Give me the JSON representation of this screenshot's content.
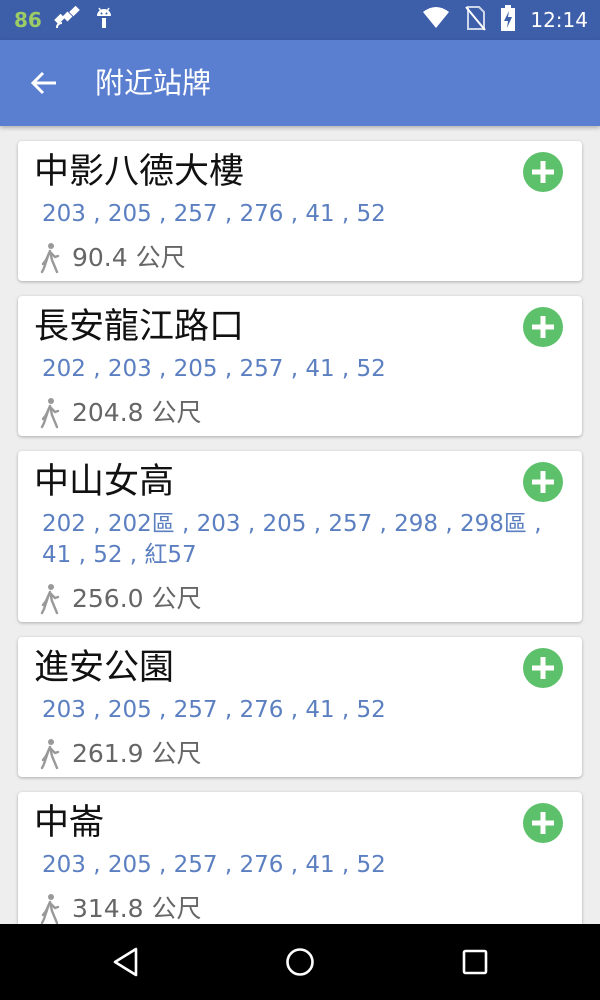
{
  "status_bar": {
    "badge": "86",
    "time": "12:14",
    "icons": [
      "satellite-fake-gps-icon",
      "android-debug-icon",
      "wifi-icon",
      "no-sim-icon",
      "battery-charging-icon"
    ]
  },
  "app_bar": {
    "title": "附近站牌",
    "back_icon": "arrow-back-icon"
  },
  "colors": {
    "status_bar": "#3d5ea8",
    "app_bar": "#5b7fd0",
    "route_text": "#5b7fc0",
    "add_button": "#5cc16a",
    "background": "#eeeeee"
  },
  "stops": [
    {
      "name": "中影八德大樓",
      "routes": "203 , 205 , 257 , 276 , 41 , 52",
      "distance": "90.4 公尺"
    },
    {
      "name": "長安龍江路口",
      "routes": "202 , 203 , 205 , 257 , 41 , 52",
      "distance": "204.8 公尺"
    },
    {
      "name": "中山女高",
      "routes": "202 , 202區 , 203 , 205 , 257 , 298 , 298區 , 41 , 52 , 紅57",
      "distance": "256.0 公尺"
    },
    {
      "name": "進安公園",
      "routes": "203 , 205 , 257 , 276 , 41 , 52",
      "distance": "261.9 公尺"
    },
    {
      "name": "中崙",
      "routes": "203 , 205 , 257 , 276 , 41 , 52",
      "distance": "314.8 公尺"
    }
  ],
  "nav_bar": {
    "buttons": [
      "back-triangle-icon",
      "home-circle-icon",
      "recents-square-icon"
    ]
  }
}
